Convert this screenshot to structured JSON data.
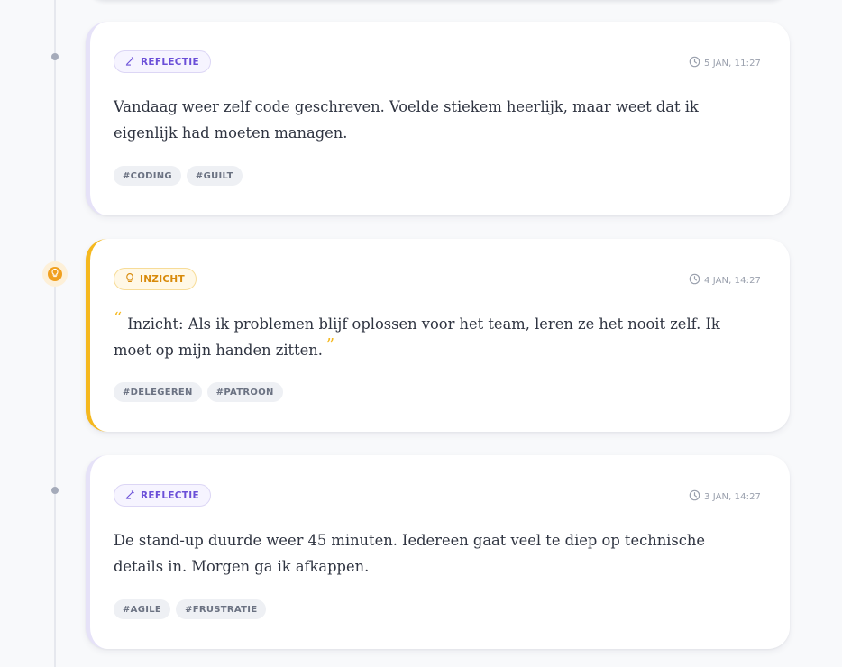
{
  "entries": [
    {
      "type_label": "REFLECTIE",
      "type_icon": "pen-icon",
      "timestamp": "5 JAN, 11:27",
      "text": "Vandaag weer zelf code geschreven. Voelde stiekem heerlijk, maar weet dat ik eigenlijk had moeten managen.",
      "tags": [
        "#CODING",
        "#GUILT"
      ]
    },
    {
      "type_label": "INZICHT",
      "type_icon": "lightbulb-icon",
      "timestamp": "4 JAN, 14:27",
      "quote_open": "“",
      "quote_close": "”",
      "text": "Inzicht: Als ik problemen blijf oplossen voor het team, leren ze het nooit zelf. Ik moet op mijn handen zitten.",
      "tags": [
        "#DELEGEREN",
        "#PATROON"
      ]
    },
    {
      "type_label": "REFLECTIE",
      "type_icon": "pen-icon",
      "timestamp": "3 JAN, 14:27",
      "text": "De stand-up duurde weer 45 minuten. Iedereen gaat veel te diep op technische details in. Morgen ga ik afkappen.",
      "tags": [
        "#AGILE",
        "#FRUSTRATIE"
      ]
    }
  ],
  "colors": {
    "reflectie_accent": "#6b4fd8",
    "inzicht_accent": "#f5b81e",
    "timeline_dot": "#a5abba",
    "insight_marker": "#f0a020"
  }
}
